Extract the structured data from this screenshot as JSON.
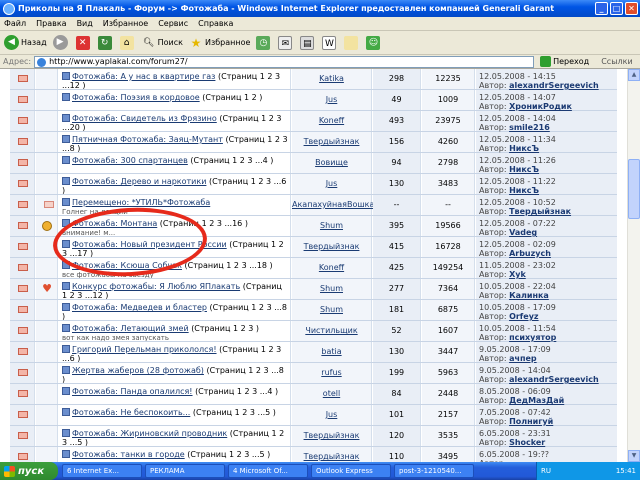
{
  "window": {
    "title": "Приколы на Я Плакаль - Форум -> Фотожаба - Windows Internet Explorer предоставлен компанией Generali Garant"
  },
  "menu": [
    "Файл",
    "Правка",
    "Вид",
    "Избранное",
    "Сервис",
    "Справка"
  ],
  "toolbar": {
    "back": "Назад",
    "search": "Поиск",
    "favorites": "Избранное"
  },
  "address": {
    "label": "Адрес:",
    "url": "http://www.yaplakal.com/forum27/",
    "go": "Переход",
    "links": "Ссылки"
  },
  "rows": [
    {
      "icon": "envelope",
      "title": "Фотожаба: А у нас в квартире газ",
      "pages": "(Страниц 1 2 3 ...12 )",
      "desc": "Ащкий откиг в пейнте",
      "author": "Katika",
      "replies": "298",
      "views": "12235",
      "date": "12.05.2008 - 14:15",
      "last": "alexandrSergeevich"
    },
    {
      "icon": "envelope",
      "title": "Фотожаба: Поэзия в кордовое",
      "pages": "(Страниц 1 2 )",
      "desc": "",
      "author": "Jus",
      "replies": "49",
      "views": "1009",
      "date": "12.05.2008 - 14:07",
      "last": "ХроникРодик"
    },
    {
      "icon": "envelope",
      "title": "Фотожаба: Свидетель из Фрязино",
      "pages": "(Страниц 1 2 3 ...20 )",
      "desc": "кто такой свидетель?",
      "author": "Koneff",
      "replies": "493",
      "views": "23975",
      "date": "12.05.2008 - 14:04",
      "last": "smile216"
    },
    {
      "icon": "envelope",
      "title": "Пятничная Фотожаба: Заяц-Мутант",
      "pages": "(Страниц 1 2 3 ...8 )",
      "desc": "",
      "author": "Твердыйзнак",
      "replies": "156",
      "views": "4260",
      "date": "12.05.2008 - 11:34",
      "last": "НиксЪ"
    },
    {
      "icon": "envelope",
      "title": "Фотожаба: 300 спартанцев",
      "pages": "(Страниц 1 2 3 ...4 )",
      "desc": "",
      "author": "Вовище",
      "replies": "94",
      "views": "2798",
      "date": "12.05.2008 - 11:26",
      "last": "НиксЪ"
    },
    {
      "icon": "envelope",
      "title": "Фотожаба: Дерево и наркотики",
      "pages": "(Страниц 1 2 3 ...6 )",
      "desc": "прикольная фотожаба",
      "author": "Jus",
      "replies": "130",
      "views": "3483",
      "date": "12.05.2008 - 11:22",
      "last": "НиксЪ"
    },
    {
      "icon": "moved",
      "title": "Перемещено: *УТИЛЬ*Фотожаба",
      "pages": "",
      "desc": "Голнег на лекции",
      "author": "АкапахуйнаяВошка",
      "replies": "--",
      "views": "--",
      "date": "12.05.2008 - 10:52",
      "last": "Твердыйзнак"
    },
    {
      "icon": "hand",
      "title": "Фотожаба: Монтана",
      "pages": "(Страниц 1 2 3 ...16 )",
      "desc": "внимание! м...",
      "author": "Shum",
      "replies": "395",
      "views": "19566",
      "date": "12.05.2008 - 07:22",
      "last": "Vadeg"
    },
    {
      "icon": "envelope",
      "title": "Фотожаба: Новый президент России",
      "pages": "(Страниц 1 2 3 ...17 )",
      "desc": "",
      "author": "Твердыйзнак",
      "replies": "415",
      "views": "16728",
      "date": "12.05.2008 - 02:09",
      "last": "Arbuzych"
    },
    {
      "icon": "envelope",
      "title": "Фотожаба: Ксюша Собчак",
      "pages": "(Страниц 1 2 3 ...18 )",
      "desc": "все фотожабы на звезду",
      "author": "Koneff",
      "replies": "425",
      "views": "149254",
      "date": "11.05.2008 - 23:02",
      "last": "Xyk"
    },
    {
      "icon": "heart",
      "title": "Конкурс фотожабы: Я Люблю ЯПлакать",
      "pages": "(Страниц 1 2 3 ...12 )",
      "desc": "",
      "author": "Shum",
      "replies": "277",
      "views": "7364",
      "date": "10.05.2008 - 22:04",
      "last": "Калинка"
    },
    {
      "icon": "envelope",
      "title": "Фотожаба: Медведев и бластер",
      "pages": "(Страниц 1 2 3 ...8 )",
      "desc": "",
      "author": "Shum",
      "replies": "181",
      "views": "6875",
      "date": "10.05.2008 - 17:09",
      "last": "Orfeyz"
    },
    {
      "icon": "envelope",
      "title": "Фотожаба: Летающий змей",
      "pages": "(Страниц 1 2 3 )",
      "desc": "вот как надо змея запускать",
      "author": "Чистильщик",
      "replies": "52",
      "views": "1607",
      "date": "10.05.2008 - 11:54",
      "last": "психуятор"
    },
    {
      "icon": "envelope",
      "title": "Григорий Перельман прикололся!",
      "pages": "(Страниц 1 2 3 ...6 )",
      "desc": "математик гриша перельман отжочил",
      "author": "batia",
      "replies": "130",
      "views": "3447",
      "date": "9.05.2008 - 17:09",
      "last": "ачпер"
    },
    {
      "icon": "envelope",
      "title": "Жертва жаберов (28 фотожаб)",
      "pages": "(Страниц 1 2 3 ...8 )",
      "desc": "Бедный мужик",
      "author": "rufus",
      "replies": "199",
      "views": "5963",
      "date": "9.05.2008 - 14:04",
      "last": "alexandrSergeevich"
    },
    {
      "icon": "envelope",
      "title": "Фотожаба: Панда опалился!",
      "pages": "(Страниц 1 2 3 ...4 )",
      "desc": "",
      "author": "otell",
      "replies": "84",
      "views": "2448",
      "date": "8.05.2008 - 06:09",
      "last": "ДедМазДай"
    },
    {
      "icon": "envelope",
      "title": "Фотожаба: Не беспокоить...",
      "pages": "(Страниц 1 2 3 ...5 )",
      "desc": "",
      "author": "Jus",
      "replies": "101",
      "views": "2157",
      "date": "7.05.2008 - 07:42",
      "last": "Полнигуй"
    },
    {
      "icon": "envelope",
      "title": "Фотожаба: Жириновский проводник",
      "pages": "(Страниц 1 2 3 ...5 )",
      "desc": "",
      "author": "Твердыйзнак",
      "replies": "120",
      "views": "3535",
      "date": "6.05.2008 - 23:31",
      "last": "Shocker"
    },
    {
      "icon": "envelope",
      "title": "Фотожаба: танки в городе",
      "pages": "(Страниц 1 2 3 ...5 )",
      "desc": "",
      "author": "Твердыйзнак",
      "replies": "110",
      "views": "3495",
      "date": "6.05.2008 - 19:??",
      "last": ""
    }
  ],
  "last_label": "Автор:",
  "taskbar": {
    "start": "пуск",
    "tasks": [
      "6 Internet Ex...",
      "РЕКЛАМА",
      "4 Microsoft Of...",
      "Outlook Express",
      "post-3-1210540..."
    ],
    "lang": "RU",
    "time": "15:41"
  }
}
